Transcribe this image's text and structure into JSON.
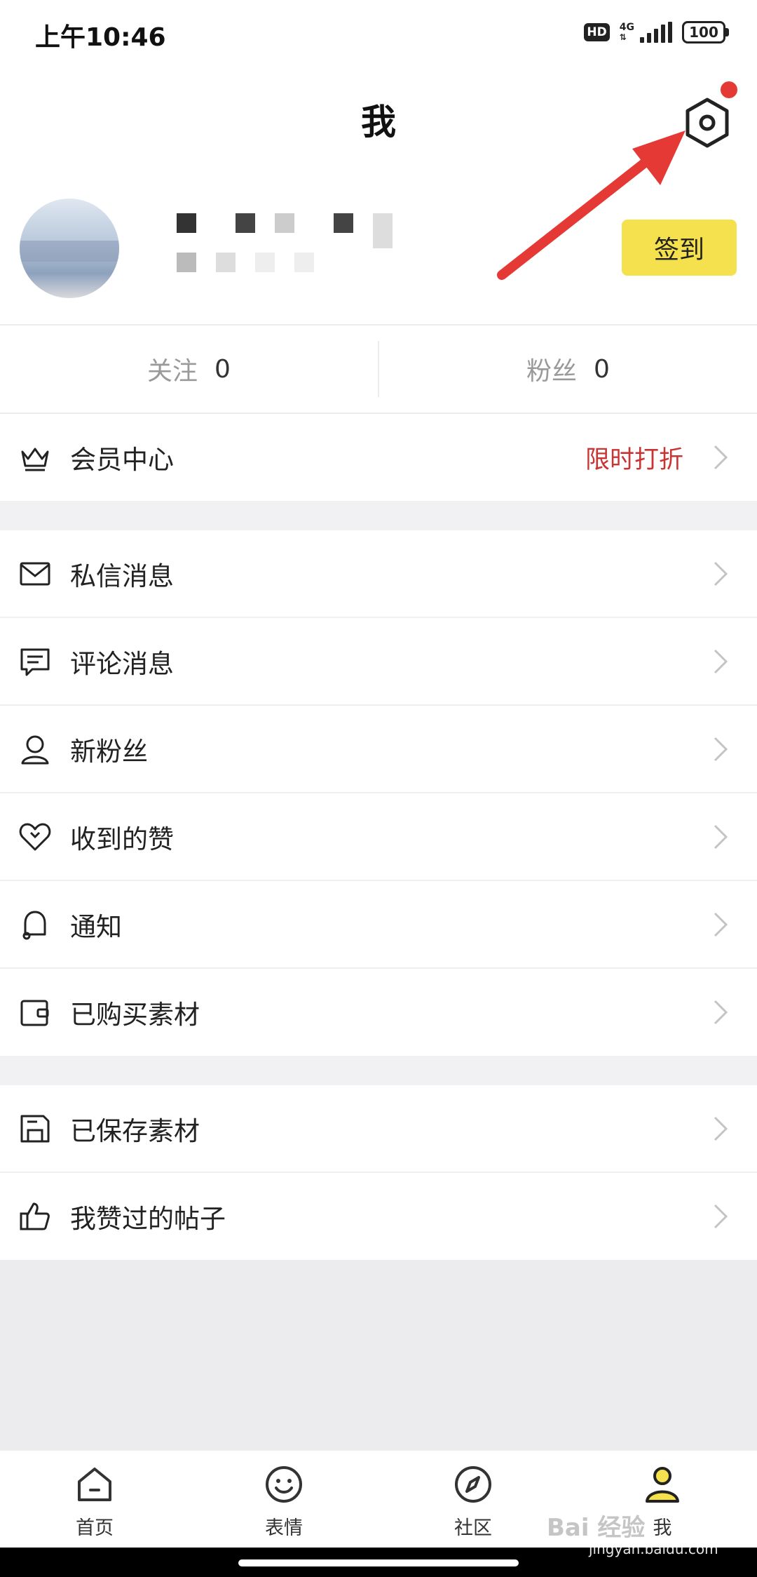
{
  "status_bar": {
    "time": "上午10:46",
    "hd": "HD",
    "network": "4G",
    "battery": "100"
  },
  "header": {
    "title": "我",
    "settings_icon": "hexagon-gear-icon"
  },
  "profile": {
    "signin_label": "签到"
  },
  "stats": {
    "follow_label": "关注",
    "follow_count": "0",
    "fans_label": "粉丝",
    "fans_count": "0"
  },
  "member": {
    "label": "会员中心",
    "promo": "限时打折",
    "icon": "crown-icon",
    "promo_color": "#c93434"
  },
  "menu_group_1": [
    {
      "label": "私信消息",
      "icon": "mail-icon"
    },
    {
      "label": "评论消息",
      "icon": "comment-icon"
    },
    {
      "label": "新粉丝",
      "icon": "person-icon"
    },
    {
      "label": "收到的赞",
      "icon": "heart-icon"
    },
    {
      "label": "通知",
      "icon": "bell-icon"
    },
    {
      "label": "已购买素材",
      "icon": "wallet-icon"
    }
  ],
  "menu_group_2": [
    {
      "label": "已保存素材",
      "icon": "save-box-icon"
    },
    {
      "label": "我赞过的帖子",
      "icon": "thumbs-up-icon"
    }
  ],
  "tabbar": [
    {
      "label": "首页",
      "icon": "home-icon"
    },
    {
      "label": "表情",
      "icon": "smiley-icon"
    },
    {
      "label": "社区",
      "icon": "compass-icon"
    },
    {
      "label": "我",
      "icon": "user-filled-icon"
    }
  ],
  "colors": {
    "accent_yellow": "#f5e04e",
    "annotation_red": "#e53935"
  },
  "watermark": {
    "text": "Bai 经验",
    "url": "jingyan.baidu.com"
  }
}
